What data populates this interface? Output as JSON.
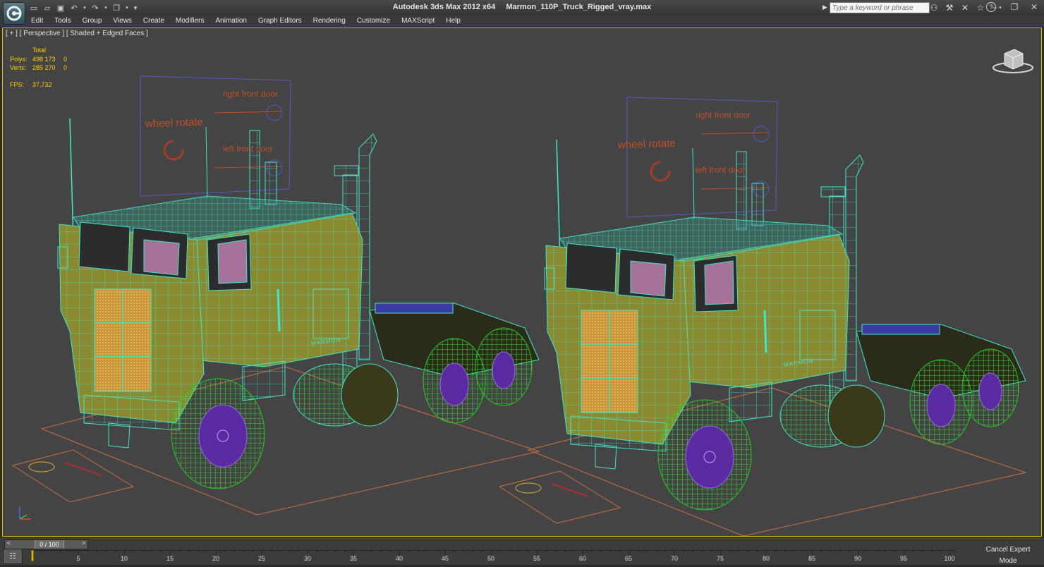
{
  "titlebar": {
    "app_name": "Autodesk 3ds Max  2012 x64",
    "file_name": "Marmon_110P_Truck_Rigged_vray.max",
    "search_placeholder": "Type a keyword or phrase"
  },
  "quick_access": [
    "new-icon",
    "open-icon",
    "save-icon",
    "undo-icon",
    "undo-dropdown-icon",
    "redo-icon",
    "redo-dropdown-icon",
    "project-folder-icon",
    "project-dropdown-icon",
    "customize-dropdown-icon"
  ],
  "menu": [
    "Edit",
    "Tools",
    "Group",
    "Views",
    "Create",
    "Modifiers",
    "Animation",
    "Graph Editors",
    "Rendering",
    "Customize",
    "MAXScript",
    "Help"
  ],
  "viewport": {
    "label": "[ + ] [ Perspective ] [ Shaded + Edged Faces ]",
    "stats": {
      "header": "Total",
      "rows": [
        {
          "label": "Polys:",
          "total": "498 173",
          "selected": "0"
        },
        {
          "label": "Verts:",
          "total": "285 270",
          "selected": "0"
        }
      ],
      "fps_label": "FPS:",
      "fps_value": "37,732"
    },
    "rig_panels": [
      {
        "wheel": "wheel rotate",
        "right_door": "right front door",
        "left_door": "left front door"
      },
      {
        "wheel": "wheel rotate",
        "right_door": "right front door",
        "left_door": "left front door"
      }
    ],
    "truck_brand": "MARMON",
    "colors": {
      "wireframe": "#40e8c8",
      "body": "#8a8a30",
      "grille": "#d8a33a",
      "tires": "#22cc22",
      "rims": "#5a2aa0",
      "rig_text": "#c0502a",
      "grid_line": "#c87040",
      "stats": "#ffd000",
      "active_border": "#e0c000"
    }
  },
  "timeline": {
    "slider_label": "0 / 100",
    "current_frame": 0,
    "ticks": [
      "5",
      "10",
      "15",
      "20",
      "25",
      "30",
      "35",
      "40",
      "45",
      "50",
      "55",
      "60",
      "65",
      "70",
      "75",
      "80",
      "85",
      "90",
      "95",
      "100"
    ]
  },
  "expert_mode_label": "Cancel Expert Mode"
}
